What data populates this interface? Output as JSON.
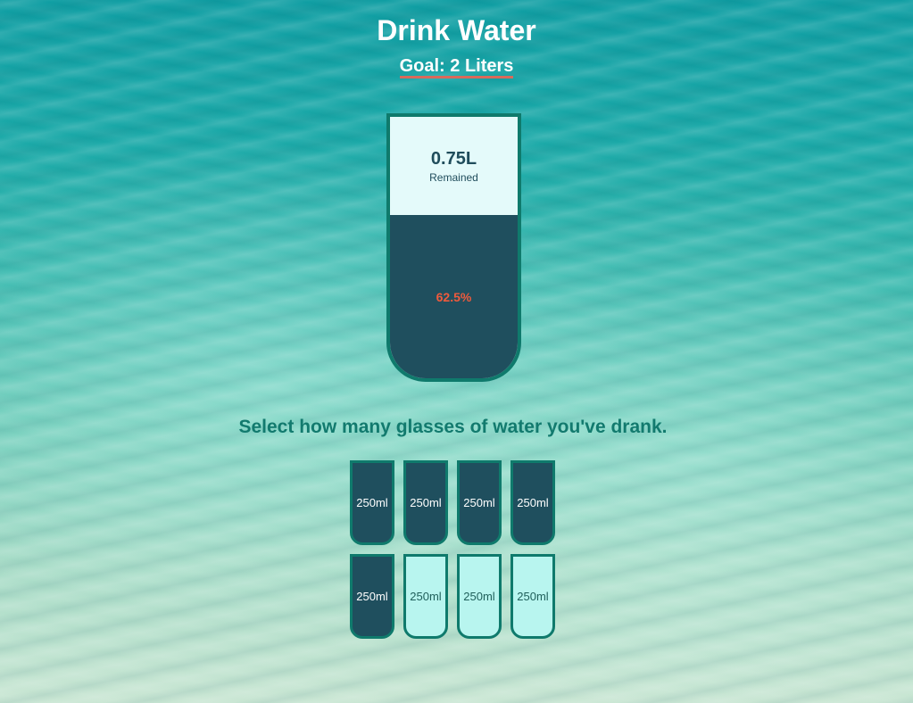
{
  "header": {
    "title": "Drink Water",
    "goal": "Goal: 2 Liters"
  },
  "big_cup": {
    "remained_value": "0.75L",
    "remained_label": "Remained",
    "percentage": "62.5%",
    "fill_fraction": 0.625
  },
  "instruction": "Select how many glasses of water you've drank.",
  "cups": [
    {
      "label": "250ml",
      "full": true
    },
    {
      "label": "250ml",
      "full": true
    },
    {
      "label": "250ml",
      "full": true
    },
    {
      "label": "250ml",
      "full": true
    },
    {
      "label": "250ml",
      "full": true
    },
    {
      "label": "250ml",
      "full": false
    },
    {
      "label": "250ml",
      "full": false
    },
    {
      "label": "250ml",
      "full": false
    }
  ],
  "colors": {
    "full_cup": "#1f4f5e",
    "empty_cup": "#b8f5ef",
    "border": "#0f7a6c",
    "percent_text": "#ef5a3c"
  }
}
